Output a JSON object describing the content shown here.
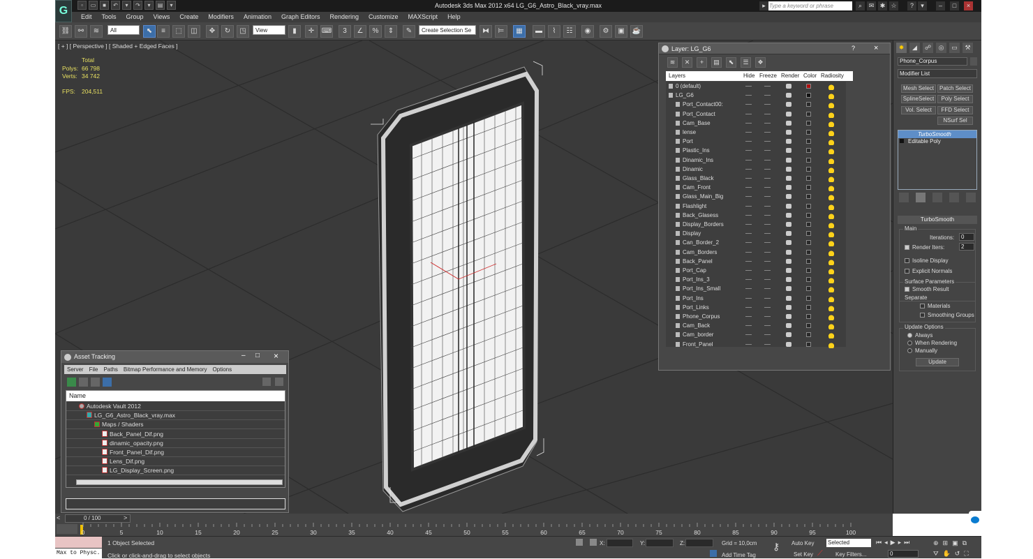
{
  "app": {
    "title": "Autodesk 3ds Max  2012 x64     LG_G6_Astro_Black_vray.max",
    "search_placeholder": "Type a keyword or phrase"
  },
  "menu": [
    "Edit",
    "Tools",
    "Group",
    "Views",
    "Create",
    "Modifiers",
    "Animation",
    "Graph Editors",
    "Rendering",
    "Customize",
    "MAXScript",
    "Help"
  ],
  "toolbar": {
    "filter_select": "All",
    "refcoord_select": "View",
    "named_selection": "Create Selection Se"
  },
  "viewport": {
    "label": "[ + ] [ Perspective ] [ Shaded + Edged Faces ]",
    "stats": {
      "total_label": "Total",
      "polys_label": "Polys:",
      "polys_value": "66 798",
      "verts_label": "Verts:",
      "verts_value": "34 742",
      "fps_label": "FPS:",
      "fps_value": "204,511"
    }
  },
  "layer_dialog": {
    "title": "Layer: LG_G6",
    "help_btn": "?",
    "close_btn": "×",
    "columns": {
      "layers": "Layers",
      "hide": "Hide",
      "freeze": "Freeze",
      "render": "Render",
      "color": "Color",
      "radiosity": "Radiosity"
    },
    "rows": [
      {
        "name": "0 (default)",
        "level": 0,
        "color": "#b01010"
      },
      {
        "name": "LG_G6",
        "level": 0,
        "color": "#111111"
      },
      {
        "name": "Port_Contact00:",
        "level": 1
      },
      {
        "name": "Port_Contact",
        "level": 1
      },
      {
        "name": "Cam_Base",
        "level": 1
      },
      {
        "name": "lense",
        "level": 1
      },
      {
        "name": "Port",
        "level": 1
      },
      {
        "name": "Plastic_Ins",
        "level": 1
      },
      {
        "name": "Dinamic_Ins",
        "level": 1
      },
      {
        "name": "Dinamic",
        "level": 1
      },
      {
        "name": "Glass_Black",
        "level": 1
      },
      {
        "name": "Cam_Front",
        "level": 1
      },
      {
        "name": "Glass_Main_Big",
        "level": 1
      },
      {
        "name": "Flashlight",
        "level": 1
      },
      {
        "name": "Back_Glasess",
        "level": 1
      },
      {
        "name": "Display_Borders",
        "level": 1
      },
      {
        "name": "Display",
        "level": 1
      },
      {
        "name": "Can_Border_2",
        "level": 1
      },
      {
        "name": "Cam_Borders",
        "level": 1
      },
      {
        "name": "Back_Panel",
        "level": 1
      },
      {
        "name": "Port_Cap",
        "level": 1
      },
      {
        "name": "Port_Ins_3",
        "level": 1
      },
      {
        "name": "Port_Ins_Small",
        "level": 1
      },
      {
        "name": "Port_Ins",
        "level": 1
      },
      {
        "name": "Port_Links",
        "level": 1
      },
      {
        "name": "Phone_Corpus",
        "level": 1
      },
      {
        "name": "Cam_Back",
        "level": 1
      },
      {
        "name": "Cam_border",
        "level": 1
      },
      {
        "name": "Front_Panel",
        "level": 1
      }
    ]
  },
  "asset_tracking": {
    "title": "Asset Tracking",
    "menu": [
      "Server",
      "File",
      "Paths",
      "Bitmap Performance and Memory",
      "Options"
    ],
    "tree_header": "Name",
    "rows": [
      {
        "name": "Autodesk Vault 2012",
        "indent": 0,
        "kind": "vault"
      },
      {
        "name": "LG_G6_Astro_Black_vray.max",
        "indent": 1,
        "kind": "max"
      },
      {
        "name": "Maps / Shaders",
        "indent": 2,
        "kind": "folder"
      },
      {
        "name": "Back_Panel_Dif.png",
        "indent": 3,
        "kind": "file"
      },
      {
        "name": "dinamic_opacity.png",
        "indent": 3,
        "kind": "file"
      },
      {
        "name": "Front_Panel_Dif.png",
        "indent": 3,
        "kind": "file"
      },
      {
        "name": "Lens_Dif.png",
        "indent": 3,
        "kind": "file"
      },
      {
        "name": "LG_Display_Screen.png",
        "indent": 3,
        "kind": "file"
      }
    ]
  },
  "command_panel": {
    "object_name": "Phone_Corpus",
    "modifier_list": "Modifier List",
    "buttons": [
      "Mesh Select",
      "Patch Select",
      "SplineSelect",
      "Poly Select",
      "Vol. Select",
      "FFD Select",
      "NSurf Sel"
    ],
    "stack": [
      "TurboSmooth",
      "Editable Poly"
    ],
    "rollout_title": "TurboSmooth",
    "main_label": "Main",
    "iterations_label": "Iterations:",
    "iterations_value": "0",
    "render_iters_label": "Render Iters:",
    "render_iters_value": "2",
    "isoline": "Isoline Display",
    "explicit": "Explicit Normals",
    "surface_label": "Surface Parameters",
    "smooth_result": "Smooth Result",
    "separate": "Separate",
    "materials": "Materials",
    "smoothing_groups": "Smoothing Groups",
    "update_options": "Update Options",
    "always": "Always",
    "when_rendering": "When Rendering",
    "manually": "Manually",
    "update_btn": "Update"
  },
  "timeline": {
    "frame_counter": "0 / 100",
    "ticks": [
      "0",
      "5",
      "10",
      "15",
      "20",
      "25",
      "30",
      "35",
      "40",
      "45",
      "50",
      "55",
      "60",
      "65",
      "70",
      "75",
      "80",
      "85",
      "90",
      "95",
      "100"
    ]
  },
  "status": {
    "maxscript": "Max to Physc.",
    "selected": "1 Object Selected",
    "prompt": "Click or click-and-drag to select objects",
    "x_label": "X:",
    "y_label": "Y:",
    "z_label": "Z:",
    "grid": "Grid = 10,0cm",
    "add_time_tag": "Add Time Tag",
    "auto_key": "Auto Key",
    "selected_select": "Selected",
    "set_key": "Set Key",
    "key_filters": "Key Filters...",
    "frame_value": "0"
  }
}
